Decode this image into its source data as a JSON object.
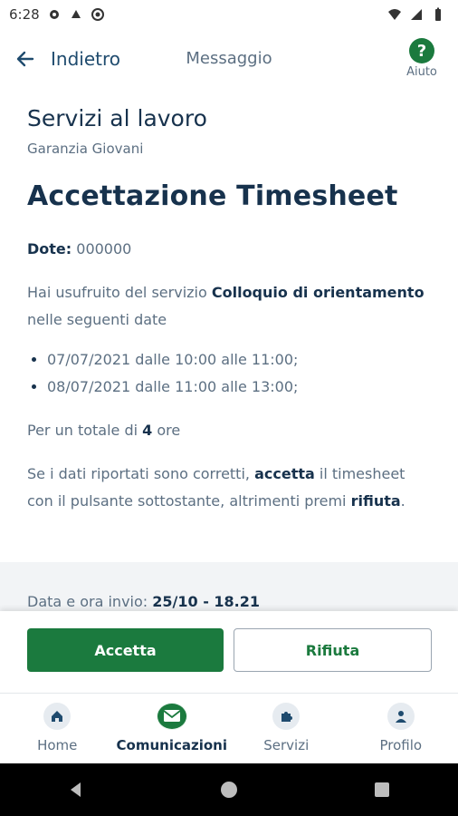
{
  "status_bar": {
    "time": "6:28"
  },
  "header": {
    "back_label": "Indietro",
    "title": "Messaggio",
    "help_label": "Aiuto",
    "help_glyph": "?"
  },
  "message": {
    "service_title": "Servizi al lavoro",
    "service_subtitle": "Garanzia Giovani",
    "title": "Accettazione Timesheet",
    "dote_label": "Dote:",
    "dote_value": "000000",
    "intro_prefix": "Hai usufruito del servizio ",
    "intro_service": "Colloquio di orientamento",
    "intro_suffix": "nelle seguenti date",
    "dates": [
      "07/07/2021 dalle 10:00 alle 11:00;",
      "08/07/2021 dalle 11:00 alle 13:00;"
    ],
    "total_prefix": "Per un totale di ",
    "total_hours": "4",
    "total_suffix": " ore",
    "notice_1": "Se i dati riportati sono corretti, ",
    "notice_accept": "accetta",
    "notice_2": " il timesheet con il pulsante sottostante, altrimenti premi ",
    "notice_reject": "rifiuta",
    "notice_3": ".",
    "sent_label": "Data e ora invio: ",
    "sent_value": "25/10 - 18.21"
  },
  "actions": {
    "accept": "Accetta",
    "reject": "Rifiuta"
  },
  "bottom_nav": {
    "items": [
      {
        "label": "Home",
        "icon": "home-icon"
      },
      {
        "label": "Comunicazioni",
        "icon": "mail-icon",
        "active": true
      },
      {
        "label": "Servizi",
        "icon": "puzzle-icon"
      },
      {
        "label": "Profilo",
        "icon": "person-icon"
      }
    ]
  },
  "colors": {
    "primary": "#1b7a3e",
    "text_dark": "#17324d",
    "text_muted": "#5c6f82"
  }
}
